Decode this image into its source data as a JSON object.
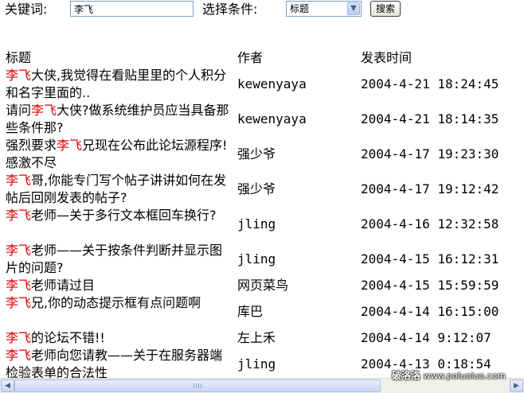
{
  "search": {
    "keyword_label": "关键词:",
    "keyword_value": "李飞",
    "condition_label": "选择条件:",
    "condition_value": "标题",
    "submit_label": "搜索"
  },
  "table": {
    "keyword": "李飞",
    "headers": {
      "title": "标题",
      "author": "作者",
      "date": "发表时间"
    },
    "rows": [
      {
        "title_before": "",
        "title_after": "大侠,我觉得在看贴里里的个人积分和名字里面的..",
        "author": "kewenyaya",
        "date": "2004-4-21  18:24:45"
      },
      {
        "title_before": "请问",
        "title_after": "大侠?做系统维护员应当具备那些条件那?",
        "author": "kewenyaya",
        "date": "2004-4-21  18:14:35"
      },
      {
        "title_before": "强烈要求",
        "title_after": "兄现在公布此论坛源程序!感激不尽",
        "author": "强少爷",
        "date": "2004-4-17  19:23:30"
      },
      {
        "title_before": "",
        "title_after": "哥,你能专门写个帖子讲讲如何在发帖后回刚发表的帖子?",
        "author": "强少爷",
        "date": "2004-4-17  19:12:42"
      },
      {
        "title_before": "",
        "title_after": "老师—关于多行文本框回车换行?",
        "author": "jling",
        "date": "2004-4-16  12:32:58"
      },
      {
        "title_before": "",
        "title_after": "老师——关于按条件判断并显示图片的问题?",
        "author": "jling",
        "date": "2004-4-15  16:12:31"
      },
      {
        "title_before": "",
        "title_after": "老师请过目",
        "author": "网页菜鸟",
        "date": "2004-4-15  15:59:59"
      },
      {
        "title_before": "",
        "title_after": "兄,你的动态提示框有点问题啊",
        "author": "库巴",
        "date": "2004-4-14  16:15:00"
      },
      {
        "title_before": "",
        "title_after": "的论坛不错!!",
        "author": "左上禾",
        "date": "2004-4-14  9:12:07"
      },
      {
        "title_before": "",
        "title_after": "老师向您请教——关于在服务器端检验表单的合法性",
        "author": "jling",
        "date": "2004-4-13  0:18:54"
      }
    ]
  },
  "watermark": {
    "text": "破洛洛",
    "url": "www.poluoluo.com"
  },
  "icons": {
    "select_arrow": "chevron-down-icon",
    "scroll_left": "arrow-left-icon",
    "scroll_right": "arrow-right-icon"
  }
}
